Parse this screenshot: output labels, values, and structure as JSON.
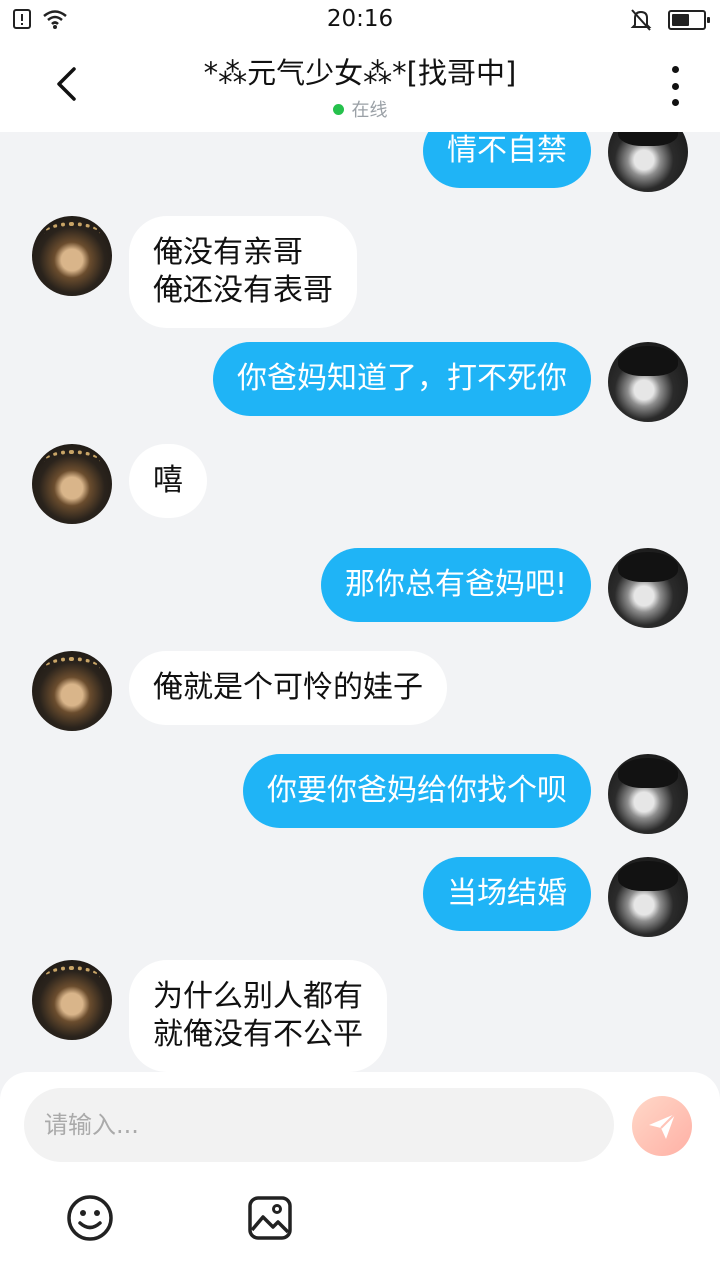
{
  "statusbar": {
    "time": "20:16",
    "battery_level": 0.55
  },
  "header": {
    "title": "*⁂元气少女⁂*[找哥中]",
    "status": "在线",
    "status_color": "#25c14c"
  },
  "messages": [
    {
      "side": "out",
      "lines": [
        "情不自禁"
      ]
    },
    {
      "side": "in",
      "lines": [
        "俺没有亲哥",
        "俺还没有表哥"
      ]
    },
    {
      "side": "out",
      "lines": [
        "你爸妈知道了，打不死你"
      ]
    },
    {
      "side": "in",
      "lines": [
        "嘻"
      ]
    },
    {
      "side": "out",
      "lines": [
        "那你总有爸妈吧!"
      ]
    },
    {
      "side": "in",
      "lines": [
        "俺就是个可怜的娃子"
      ]
    },
    {
      "side": "out",
      "lines": [
        "你要你爸妈给你找个呗"
      ]
    },
    {
      "side": "out",
      "lines": [
        "当场结婚"
      ]
    },
    {
      "side": "in",
      "lines": [
        "为什么别人都有",
        "就俺没有不公平"
      ]
    }
  ],
  "composer": {
    "placeholder": "请输入..."
  },
  "colors": {
    "out_bubble": "#1fb4f6",
    "in_bubble": "#ffffff",
    "background": "#f2f3f5"
  },
  "icons": {
    "status_left": [
      "sim-icon",
      "wifi-icon"
    ],
    "status_right": [
      "mute-icon",
      "battery-icon"
    ],
    "header": [
      "back-icon",
      "more-icon"
    ],
    "composer": [
      "send-icon",
      "emoji-icon",
      "image-icon"
    ]
  }
}
